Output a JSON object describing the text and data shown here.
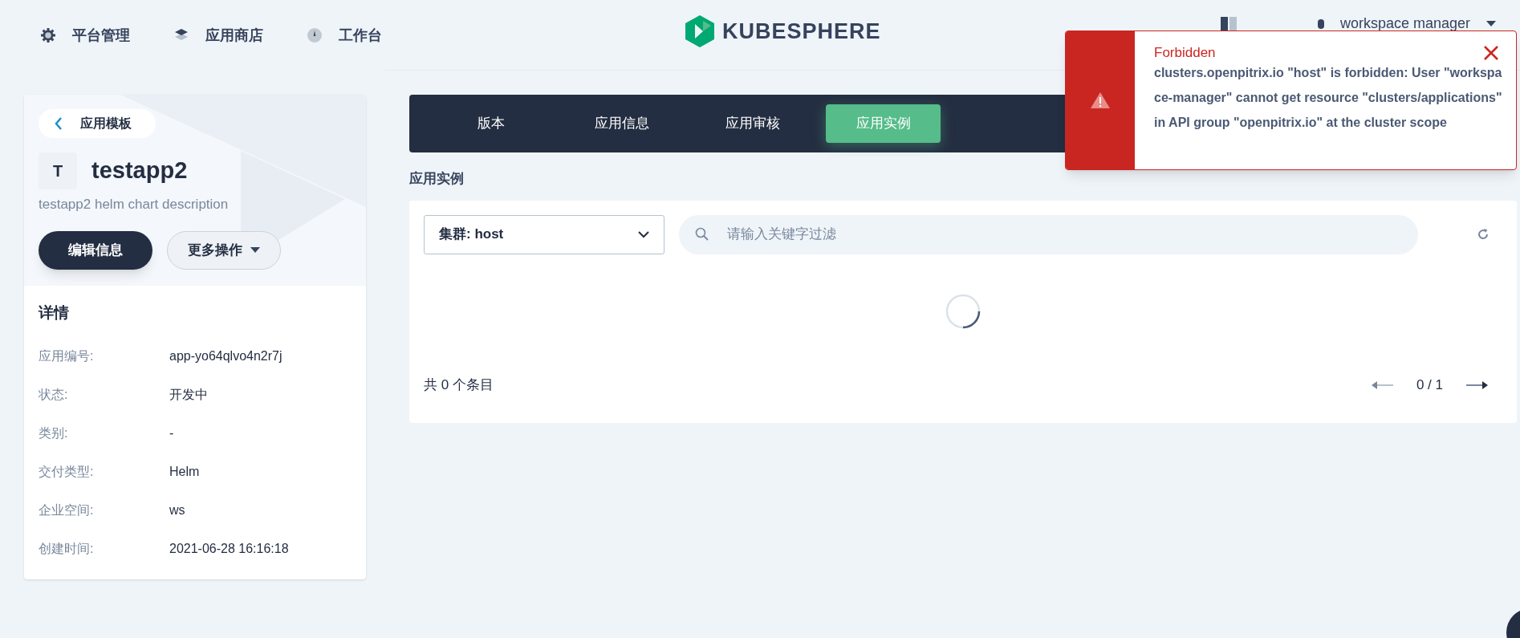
{
  "header": {
    "nav": [
      {
        "label": "平台管理"
      },
      {
        "label": "应用商店"
      },
      {
        "label": "工作台"
      }
    ],
    "logo": "KUBESPHERE",
    "user": "workspace manager"
  },
  "sidebar": {
    "back": "应用模板",
    "avatar": "T",
    "name": "testapp2",
    "description": "testapp2 helm chart description",
    "buttons": [
      {
        "label": "编辑信息",
        "kind": "primary"
      },
      {
        "label": "更多操作",
        "kind": "dropdown"
      }
    ],
    "details_title": "详情",
    "details": [
      {
        "label": "应用编号:",
        "value": "app-yo64qlvo4n2r7j"
      },
      {
        "label": "状态:",
        "value": "开发中"
      },
      {
        "label": "类别:",
        "value": "-"
      },
      {
        "label": "交付类型:",
        "value": "Helm"
      },
      {
        "label": "企业空间:",
        "value": "ws"
      },
      {
        "label": "创建时间:",
        "value": "2021-06-28 16:16:18"
      }
    ]
  },
  "tabs": [
    {
      "label": "版本",
      "selected": false
    },
    {
      "label": "应用信息",
      "selected": false
    },
    {
      "label": "应用审核",
      "selected": false
    },
    {
      "label": "应用实例",
      "selected": true
    }
  ],
  "section_title": "应用实例",
  "filter": {
    "cluster": "集群: host",
    "search_placeholder": "请输入关键字过滤"
  },
  "loading": true,
  "footer": {
    "total": "共 0 个条目",
    "page": "0 / 1"
  },
  "toast": {
    "title": "Forbidden",
    "message": "clusters.openpitrix.io \"host\" is forbidden: User \"workspace-manager\" cannot get resource \"clusters/applications\" in API group \"openpitrix.io\" at the cluster scope"
  }
}
